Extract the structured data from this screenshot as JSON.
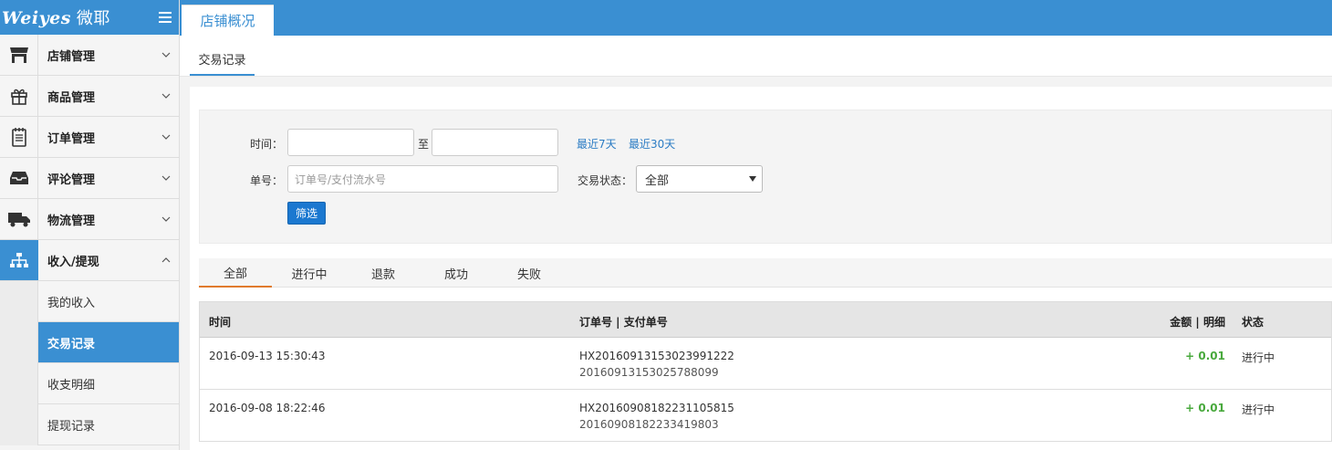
{
  "brand": {
    "logo_latin": "Weiyes",
    "logo_cn": "微耶"
  },
  "sidebar": {
    "items": [
      {
        "label": "店铺管理",
        "icon": "store-icon",
        "expanded": false
      },
      {
        "label": "商品管理",
        "icon": "gift-icon",
        "expanded": false
      },
      {
        "label": "订单管理",
        "icon": "order-notepad-icon",
        "expanded": false
      },
      {
        "label": "评论管理",
        "icon": "inbox-tray-icon",
        "expanded": false
      },
      {
        "label": "物流管理",
        "icon": "truck-icon",
        "expanded": false
      },
      {
        "label": "收入/提现",
        "icon": "org-chart-icon",
        "expanded": true
      }
    ],
    "sub_items": [
      {
        "label": "我的收入",
        "active": false
      },
      {
        "label": "交易记录",
        "active": true
      },
      {
        "label": "收支明细",
        "active": false
      },
      {
        "label": "提现记录",
        "active": false
      }
    ]
  },
  "topbar": {
    "tab": "店铺概况"
  },
  "subnav": {
    "tab": "交易记录"
  },
  "filter": {
    "time_label": "时间：",
    "to_label": "至",
    "start_value": "",
    "end_value": "",
    "quick_7": "最近7天",
    "quick_30": "最近30天",
    "order_label": "单号：",
    "order_placeholder": "订单号/支付流水号",
    "status_label": "交易状态：",
    "status_selected": "全部",
    "submit": "筛选"
  },
  "tabs": [
    "全部",
    "进行中",
    "退款",
    "成功",
    "失败"
  ],
  "active_tab": 0,
  "table": {
    "headers": {
      "time": "时间",
      "order": "订单号 | 支付单号",
      "amount": "金额 | 明细",
      "status": "状态"
    },
    "rows": [
      {
        "time": "2016-09-13 15:30:43",
        "order_no": "HX20160913153023991222",
        "pay_no": "20160913153025788099",
        "amount": "+ 0.01",
        "status": "进行中"
      },
      {
        "time": "2016-09-08 18:22:46",
        "order_no": "HX20160908182231105815",
        "pay_no": "20160908182233419803",
        "amount": "+ 0.01",
        "status": "进行中"
      }
    ]
  },
  "colors": {
    "primary": "#3a8fd2",
    "accent_tab": "#e07a2d",
    "amount_positive": "#49a93d",
    "button": "#1b78d0"
  }
}
